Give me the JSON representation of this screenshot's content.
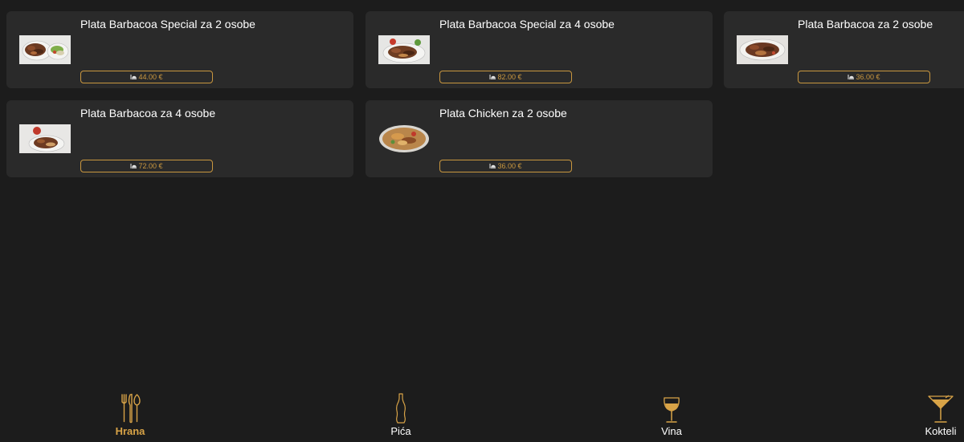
{
  "menu_items": [
    {
      "name": "Plata Barbacoa Special za 2 osobe",
      "price": "44.00 €",
      "image": "grilled-platter-photo"
    },
    {
      "name": "Plata Barbacoa Special za 4 osobe",
      "price": "82.00 €",
      "image": "grilled-platter-photo"
    },
    {
      "name": "Plata Barbacoa za 2 osobe",
      "price": "36.00 €",
      "image": "grilled-platter-photo"
    },
    {
      "name": "Plata Barbacoa za 4 osobe",
      "price": "72.00 €",
      "image": "grilled-platter-photo"
    },
    {
      "name": "Plata Chicken za 2 osobe",
      "price": "36.00 €",
      "image": "chicken-platter-photo"
    }
  ],
  "bottom_nav": {
    "active": "food",
    "items": [
      {
        "label": "Hrana",
        "icon": "fork-knife-icon"
      },
      {
        "label": "Pića",
        "icon": "bottle-icon"
      },
      {
        "label": "Vina",
        "icon": "wine-glass-icon"
      },
      {
        "label": "Kokteli",
        "icon": "cocktail-glass-icon"
      }
    ]
  },
  "colors": {
    "background": "#1c1c1c",
    "card": "#2a2a2a",
    "accent": "#c9973f",
    "active_nav": "#d8a347",
    "text": "#ffffff"
  }
}
